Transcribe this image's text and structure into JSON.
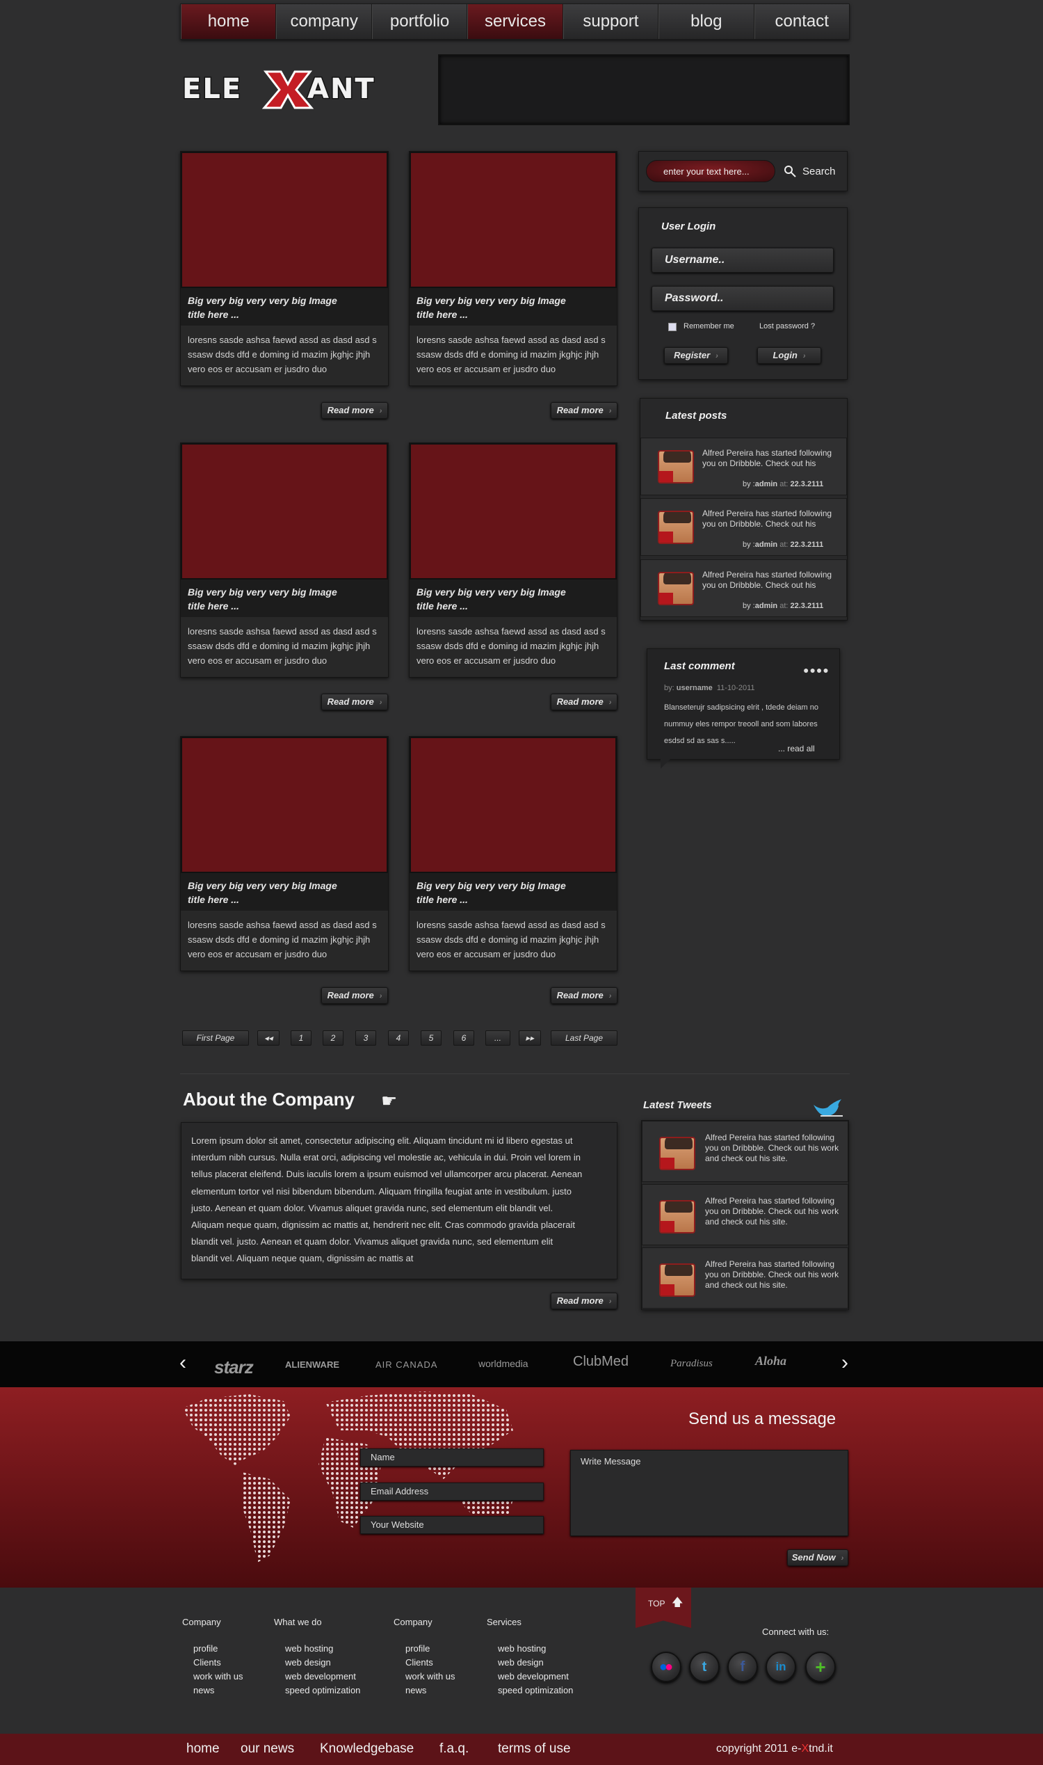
{
  "nav": {
    "items": [
      "home",
      "company",
      "portfolio",
      "services",
      "support",
      "blog",
      "contact"
    ]
  },
  "logo": {
    "text": "ELEXANT"
  },
  "cards": [
    {
      "title_line1": "Big very big very very big Image",
      "title_line2": "title here ...",
      "text": "loresns sasde ashsa faewd assd as dasd asd s ssasw dsds dfd e doming id mazim jkghjc jhjh vero eos er accusam er jusdro duo",
      "read_more": "Read more"
    },
    {
      "title_line1": "Big very big very very big Image",
      "title_line2": "title here ...",
      "text": "loresns sasde ashsa faewd assd as dasd asd s ssasw dsds dfd e doming id mazim jkghjc jhjh vero eos er accusam er jusdro duo",
      "read_more": "Read more"
    },
    {
      "title_line1": "Big very big very very big Image",
      "title_line2": "title here ...",
      "text": "loresns sasde ashsa faewd assd as dasd asd s ssasw dsds dfd e doming id mazim jkghjc jhjh vero eos er accusam er jusdro duo",
      "read_more": "Read more"
    },
    {
      "title_line1": "Big very big very very big Image",
      "title_line2": "title here ...",
      "text": "loresns sasde ashsa faewd assd as dasd asd s ssasw dsds dfd e doming id mazim jkghjc jhjh vero eos er accusam er jusdro duo",
      "read_more": "Read more"
    },
    {
      "title_line1": "Big very big very very big Image",
      "title_line2": "title here ...",
      "text": "loresns sasde ashsa faewd assd as dasd asd s ssasw dsds dfd e doming id mazim jkghjc jhjh vero eos er accusam er jusdro duo",
      "read_more": "Read more"
    },
    {
      "title_line1": "Big very big very very big Image",
      "title_line2": "title here ...",
      "text": "loresns sasde ashsa faewd assd as dasd asd s ssasw dsds dfd e doming id mazim jkghjc jhjh vero eos er accusam er jusdro duo",
      "read_more": "Read more"
    }
  ],
  "pagination": {
    "first": "First Page",
    "prev": "◂◂",
    "pages": [
      "1",
      "2",
      "3",
      "4",
      "5",
      "6",
      "..."
    ],
    "next": "▸▸",
    "last": "Last Page"
  },
  "search": {
    "placeholder": "enter your text here...",
    "button": "Search"
  },
  "login": {
    "title": "User Login",
    "username": "Username..",
    "password": "Password..",
    "remember": "Remember me",
    "lost": "Lost password ?",
    "register": "Register",
    "login": "Login"
  },
  "latest_posts": {
    "title": "Latest posts",
    "items": [
      {
        "line1": "Alfred Pereira has started following",
        "line2": "you on Dribbble. Check out his",
        "by": "by :",
        "user": "admin",
        "at": "at:",
        "date": "22.3.2111"
      },
      {
        "line1": "Alfred Pereira has started following",
        "line2": "you on Dribbble. Check out his",
        "by": "by :",
        "user": "admin",
        "at": "at:",
        "date": "22.3.2111"
      },
      {
        "line1": "Alfred Pereira has started following",
        "line2": "you on Dribbble. Check out his",
        "by": "by :",
        "user": "admin",
        "at": "at:",
        "date": "22.3.2111"
      }
    ]
  },
  "last_comment": {
    "title": "Last comment",
    "by": "by:",
    "user": "username",
    "date": "11-10-2011",
    "line1": "Blanseterujr sadipsicing elrit , tdede deiam no",
    "line2": "nummuy eles rempor treooll and som labores",
    "line3": "esdsd sd  as sas s.....",
    "read_all": "... read all"
  },
  "about": {
    "title": "About the Company",
    "lines": [
      "Lorem ipsum dolor sit amet, consectetur adipiscing elit. Aliquam tincidunt mi id libero egestas ut",
      "interdum nibh cursus. Nulla erat orci, adipiscing vel molestie ac, vehicula in dui. Proin vel lorem in",
      "tellus placerat eleifend. Duis iaculis lorem a ipsum euismod vel ullamcorper arcu placerat. Aenean",
      "elementum tortor vel nisi bibendum bibendum. Aliquam fringilla feugiat ante in vestibulum. justo",
      "justo. Aenean et quam dolor. Vivamus aliquet gravida nunc, sed elementum elit blandit vel.",
      "Aliquam neque quam, dignissim ac mattis at, hendrerit nec elit. Cras commodo gravida placerait",
      "blandit vel. justo. Aenean et quam dolor. Vivamus aliquet gravida nunc, sed elementum elit",
      "blandit vel. Aliquam neque quam, dignissim ac mattis at"
    ],
    "read_more": "Read more"
  },
  "tweets": {
    "title": "Latest Tweets",
    "items": [
      {
        "line1": "Alfred Pereira has started following",
        "line2": "you on Dribbble. Check out his work",
        "line3": "and check out his site."
      },
      {
        "line1": "Alfred Pereira has started following",
        "line2": "you on Dribbble. Check out his work",
        "line3": "and check out his site."
      },
      {
        "line1": "Alfred Pereira has started following",
        "line2": "you on Dribbble. Check out his work",
        "line3": "and check out his site."
      }
    ]
  },
  "brands": {
    "prev": "‹",
    "next": "›",
    "items": [
      "starz",
      "ALIENWARE",
      "AIR CANADA",
      "worldmedia",
      "ClubMed",
      "Paradisus",
      "Aloha"
    ]
  },
  "contact": {
    "title": "Send us a message",
    "name": "Name",
    "email": "Email Address",
    "website": "Your Website",
    "message": "Write Message",
    "send": "Send Now"
  },
  "top": {
    "label": "TOP"
  },
  "footer": {
    "columns": [
      {
        "heading": "Company",
        "links": [
          "profile",
          "Clients",
          "work with us",
          "news"
        ]
      },
      {
        "heading": "What we do",
        "links": [
          "web hosting",
          "web design",
          "web development",
          "speed optimization"
        ]
      },
      {
        "heading": "Company",
        "links": [
          "profile",
          "Clients",
          "work with us",
          "news"
        ]
      },
      {
        "heading": "Services",
        "links": [
          "web hosting",
          "web design",
          "web development",
          "speed optimization"
        ]
      }
    ],
    "connect": "Connect with us:",
    "social": [
      "flickr-icon",
      "twitter-icon",
      "facebook-icon",
      "linkedin-icon",
      "plus-icon"
    ]
  },
  "bottom": {
    "links": [
      "home",
      "our news",
      "Knowledgebase",
      "f.a.q.",
      "terms of use"
    ],
    "copyright_pre": "copyright 2011 e-",
    "copyright_x": "X",
    "copyright_post": "tnd.it"
  },
  "colors": {
    "accent": "#661418",
    "bg": "#2e2e2f",
    "red_band": "#8e1e22"
  }
}
